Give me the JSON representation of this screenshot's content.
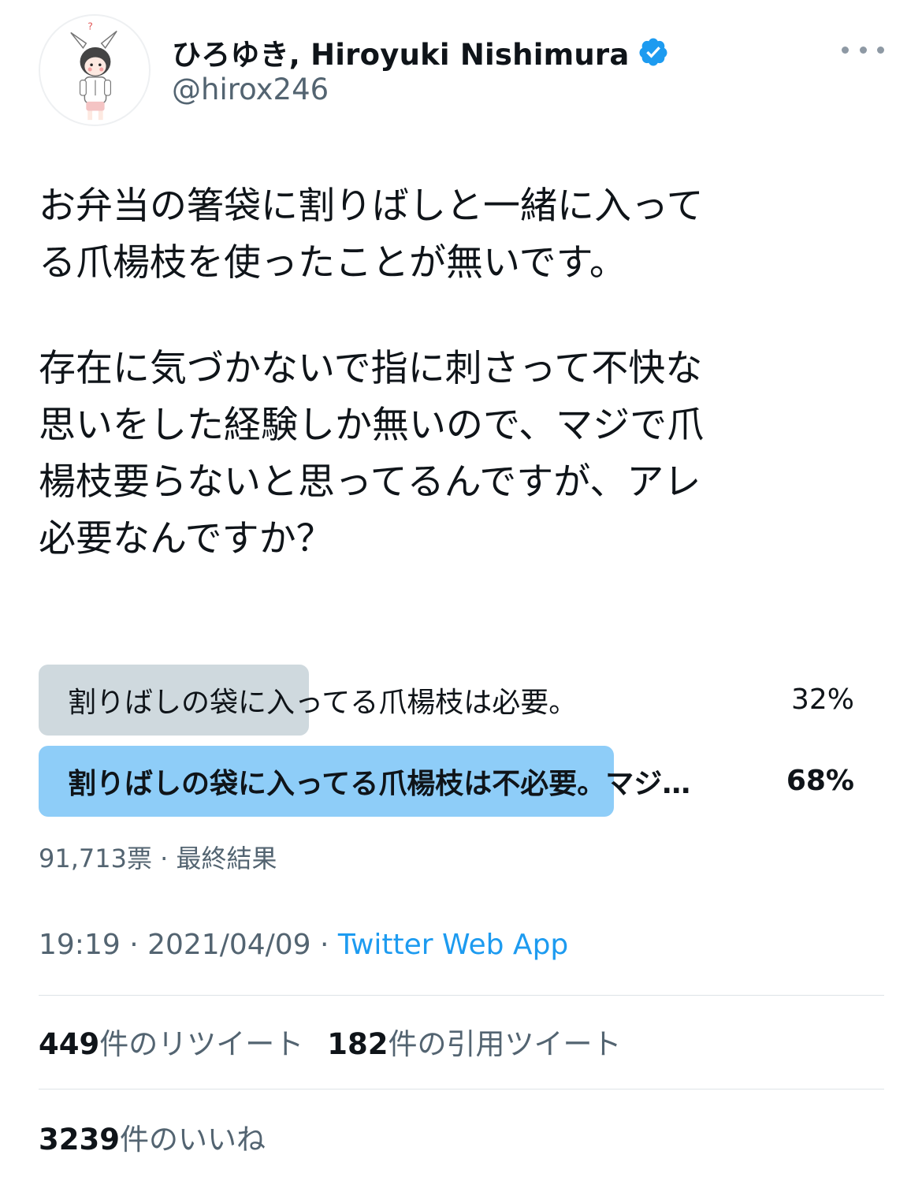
{
  "author": {
    "display_name": "ひろゆき, Hiroyuki Nishimura",
    "handle": "@hirox246",
    "verified": true,
    "avatar_icon": "bunny-ears-character-avatar"
  },
  "tweet": {
    "paragraph1": [
      "お弁当の箸袋に割りばしと一緒に入って",
      "る爪楊枝を使ったことが無いです。"
    ],
    "paragraph2": [
      "存在に気づかないで指に刺さって不快な",
      "思いをした経験しか無いので、マジで爪",
      "楊枝要らないと思ってるんですが、アレ",
      "必要なんですか？"
    ]
  },
  "poll": {
    "options": [
      {
        "label": "割りばしの袋に入ってる爪楊枝は必要。",
        "percent_text": "32%",
        "percent": 32,
        "winner": false
      },
      {
        "label": "割りばしの袋に入ってる爪楊枝は不必要。マジ…",
        "percent_text": "68%",
        "percent": 68,
        "winner": true
      }
    ],
    "meta": "91,713票 · 最終結果"
  },
  "timestamp": {
    "time_date": "19:19 · 2021/04/09 · ",
    "source": "Twitter Web App"
  },
  "stats": {
    "retweets_count": "449",
    "retweets_label": "件のリツイート",
    "quotes_count": "182",
    "quotes_label": "件の引用ツイート",
    "likes_count": "3239",
    "likes_label": "件のいいね"
  },
  "colors": {
    "text": "#0f1419",
    "secondary": "#536471",
    "link": "#1d9bf0",
    "poll_loser": "#cfd9de",
    "poll_winner": "#8ecdf8",
    "verified": "#1d9bf0"
  }
}
